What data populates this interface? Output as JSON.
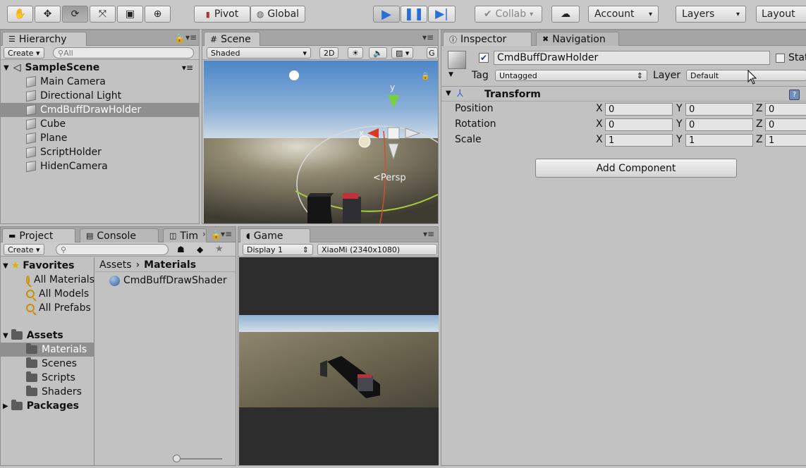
{
  "toolbar": {
    "pivot": "Pivot",
    "global": "Global",
    "collab": "Collab",
    "account": "Account",
    "layers": "Layers",
    "layout": "Layout",
    "caret": "▾"
  },
  "hierarchy": {
    "tab": "Hierarchy",
    "create": "Create",
    "search_placeholder": "All",
    "scene": "SampleScene",
    "items": [
      {
        "label": "Main Camera"
      },
      {
        "label": "Directional Light"
      },
      {
        "label": "CmdBuffDrawHolder"
      },
      {
        "label": "Cube"
      },
      {
        "label": "Plane"
      },
      {
        "label": "ScriptHolder"
      },
      {
        "label": "HidenCamera"
      }
    ],
    "selected_index": 2
  },
  "scene": {
    "tab": "Scene",
    "shading": "Shaded",
    "mode_2d": "2D",
    "persp": "Persp",
    "gizmo_y": "y",
    "gizmo_x": "x",
    "gizmos": "G"
  },
  "project": {
    "tabs": [
      "Project",
      "Console",
      "Tim"
    ],
    "create": "Create",
    "favorites": "Favorites",
    "fav_items": [
      "All Materials",
      "All Models",
      "All Prefabs"
    ],
    "assets": "Assets",
    "asset_items": [
      "Materials",
      "Scenes",
      "Scripts",
      "Shaders"
    ],
    "packages": "Packages",
    "breadcrumb": [
      "Assets",
      "Materials"
    ],
    "files": [
      "CmdBuffDrawShader"
    ]
  },
  "game": {
    "tab": "Game",
    "display": "Display 1",
    "resolution": "XiaoMi (2340x1080)"
  },
  "inspector": {
    "tabs": [
      "Inspector",
      "Navigation"
    ],
    "object_name": "CmdBuffDrawHolder",
    "static_label": "Stat",
    "tag_label": "Tag",
    "tag_value": "Untagged",
    "layer_label": "Layer",
    "layer_value": "Default",
    "component": "Transform",
    "transform": [
      {
        "label": "Position",
        "x": "0",
        "y": "0",
        "z": "0"
      },
      {
        "label": "Rotation",
        "x": "0",
        "y": "0",
        "z": "0"
      },
      {
        "label": "Scale",
        "x": "1",
        "y": "1",
        "z": "1"
      }
    ],
    "axis_x": "X",
    "axis_y": "Y",
    "axis_z": "Z",
    "add_component": "Add Component"
  },
  "colors": {
    "play_blue": "#2b6fd6",
    "selection": "#8f8f8f"
  }
}
